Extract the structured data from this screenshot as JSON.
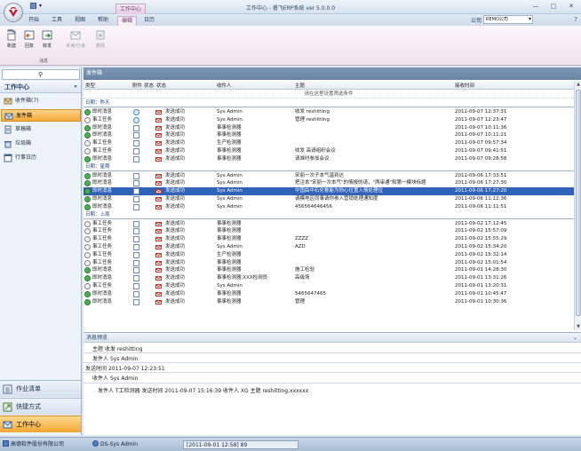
{
  "window": {
    "title": "工作中心 - 睿飞ERP系统 ver 5.0.0.0",
    "min": "—",
    "max": "□",
    "close": "✕"
  },
  "menu": {
    "context_tab": "工作中心",
    "tabs": [
      "开始",
      "工具",
      "视图",
      "帮助",
      "编辑",
      "日历"
    ],
    "active_tab": 4,
    "company_label": "公司",
    "company_value": "REMO公司"
  },
  "ribbon": {
    "buttons": [
      {
        "label": "新建",
        "enabled": true,
        "icon": "new-doc-icon"
      },
      {
        "label": "回复",
        "enabled": true,
        "icon": "reply-icon"
      },
      {
        "label": "转发",
        "enabled": true,
        "icon": "forward-icon"
      },
      {
        "label": "未读/已读",
        "enabled": false,
        "icon": "read-toggle-icon"
      },
      {
        "label": "删除",
        "enabled": false,
        "icon": "delete-icon"
      }
    ],
    "group_label": "消息"
  },
  "leftnav": {
    "header": "工作中心",
    "items": [
      {
        "label": "收件箱(7)",
        "icon": "inbox-icon"
      },
      {
        "label": "发件箱",
        "icon": "outbox-icon",
        "selected": true
      },
      {
        "label": "草稿箱",
        "icon": "draft-icon"
      },
      {
        "label": "垃圾箱",
        "icon": "trash-icon"
      },
      {
        "label": "行事日历",
        "icon": "calendar-icon"
      }
    ],
    "bottom": [
      {
        "label": "作业清单",
        "icon": "task-list-icon"
      },
      {
        "label": "快捷方式",
        "icon": "shortcut-icon"
      },
      {
        "label": "工作中心",
        "icon": "work-center-icon",
        "active": true
      }
    ]
  },
  "grid": {
    "title": "发件箱",
    "columns": [
      "类型",
      "附件",
      "状态",
      "状态",
      "收件人",
      "主题",
      "接收时间"
    ],
    "filter_hint": "请在这里设置筛选条件",
    "groups": [
      {
        "label": "日期：昨天",
        "rows": [
          {
            "type": "即时消息",
            "status": "circle",
            "state": "发送成功",
            "sender": "Sys Admin",
            "subject": "收发 reshitting",
            "time": "2011-09-07 12:37:31"
          },
          {
            "type": "事工任务",
            "status": "circle",
            "state": "发送成功",
            "sender": "Sys Admin",
            "subject": "管理 reshitting",
            "time": "2011-09-07 12:23:47"
          },
          {
            "type": "即时消息",
            "status": "box",
            "state": "发送成功",
            "sender": "事事检测器",
            "subject": "",
            "time": "2011-09-07 10:11:36"
          },
          {
            "type": "即时消息",
            "status": "box",
            "state": "发送成功",
            "sender": "事事检测器",
            "subject": "",
            "time": "2011-09-07 10:11:21"
          },
          {
            "type": "事工任务",
            "status": "box",
            "state": "发送成功",
            "sender": "生产检测器",
            "subject": "",
            "time": "2011-09-07 09:57:34"
          },
          {
            "type": "事工任务",
            "status": "box",
            "state": "发送成功",
            "sender": "事事检测器",
            "subject": "收发 高请组织会议",
            "time": "2011-09-07 09:41:51"
          },
          {
            "type": "即时消息",
            "status": "box",
            "state": "发送成功",
            "sender": "事事检测器",
            "subject": "请准时参加会议",
            "time": "2011-09-07 09:28:58"
          }
        ]
      },
      {
        "label": "日期：星期",
        "rows": [
          {
            "type": "即时消息",
            "status": "box",
            "state": "发送成功",
            "sender": "Sys Admin",
            "subject": "宋丽一次子本气温到达",
            "time": "2011-09-06 17:33:51"
          },
          {
            "type": "即时消息",
            "status": "box",
            "state": "发送成功",
            "sender": "Sys Admin",
            "subject": "把注本\"宋丽一次本气\"的情报的请，\"两审通\"和第一模块标题",
            "time": "2011-09-06 17:27:30"
          },
          {
            "type": "即时消息",
            "status": "box",
            "state": "发送成功",
            "sender": "Sys Admin",
            "subject": "中国由中石化鲁能为你心位置入情处理位",
            "time": "2011-09-06 17:27:20",
            "selected": true
          },
          {
            "type": "即时消息",
            "status": "box",
            "state": "发送成功",
            "sender": "Sys Admin",
            "subject": "请模地区同事请你参入营销处理通知度",
            "time": "2011-09-06 11:12:36"
          },
          {
            "type": "即时消息",
            "status": "box",
            "state": "发送成功",
            "sender": "Sys Admin",
            "subject": "456564646456",
            "time": "2011-09-06 11:11:51"
          }
        ]
      },
      {
        "label": "日期：上周",
        "rows": [
          {
            "type": "事工任务",
            "status": "box",
            "state": "发送成功",
            "sender": "事事检测器",
            "subject": "",
            "time": "2011-09-02 17:12:45"
          },
          {
            "type": "事工任务",
            "status": "box",
            "state": "发送成功",
            "sender": "事事检测器",
            "subject": "",
            "time": "2011-09-02 15:57:09"
          },
          {
            "type": "事工任务",
            "status": "box",
            "state": "发送成功",
            "sender": "事事检测器",
            "subject": "ZZZZ",
            "time": "2011-09-02 15:55:29"
          },
          {
            "type": "事工任务",
            "status": "box",
            "state": "发送成功",
            "sender": "Sys Admin",
            "subject": "AZD",
            "time": "2011-09-02 15:34:20"
          },
          {
            "type": "事工任务",
            "status": "box",
            "state": "发送成功",
            "sender": "生产检测器",
            "subject": "",
            "time": "2011-09-02 15:32:14"
          },
          {
            "type": "事工任务",
            "status": "box",
            "state": "发送成功",
            "sender": "事事检测器",
            "subject": "",
            "time": "2011-09-02 15:01:54"
          },
          {
            "type": "即时消息",
            "status": "box",
            "state": "发送成功",
            "sender": "事事检测器",
            "subject": "施工检验",
            "time": "2011-09-01 14:28:30"
          },
          {
            "type": "即时消息",
            "status": "box",
            "state": "发送成功",
            "sender": "事事检测器;XXX检测员",
            "subject": "高级场",
            "time": "2011-09-01 13:31:26"
          },
          {
            "type": "事工任务",
            "status": "box",
            "state": "发送成功",
            "sender": "Sys Admin",
            "subject": "",
            "time": "2011-09-01 13:20:31"
          },
          {
            "type": "即时消息",
            "status": "box",
            "state": "发送成功",
            "sender": "事事检测器",
            "subject": "5465647465",
            "time": "2011-09-01 10:45:47"
          },
          {
            "type": "即时消息",
            "status": "box",
            "state": "发送成功",
            "sender": "事事检测器",
            "subject": "管理",
            "time": "2011-09-01 10:30:36"
          }
        ]
      }
    ]
  },
  "preview": {
    "header": "消息预览",
    "subject_label": "主题",
    "subject_value": "收发 reshitting",
    "sender_label": "发件人",
    "sender_value": "Sys Admin",
    "time_label": "发送时间",
    "time_value": "2011-09-07 12:23:51",
    "receiver_label": "收件人",
    "receiver_value": "Sys Admin",
    "body": "发件人 T工检测器 发送时间 2011-09-07 15:16:39 收件人 XG 主题 reshitting,xxxxxx"
  },
  "statusbar": {
    "company": "高德软件股份有限公司",
    "user": "DS-Sys Admin",
    "datetime": "[2011-09-01 12:58] 89"
  }
}
